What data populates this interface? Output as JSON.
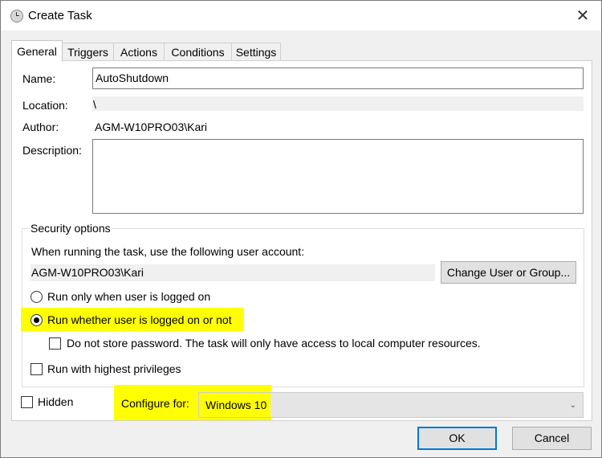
{
  "window": {
    "title": "Create Task",
    "close_icon": "close-icon"
  },
  "tabs": [
    {
      "label": "General",
      "active": true
    },
    {
      "label": "Triggers"
    },
    {
      "label": "Actions"
    },
    {
      "label": "Conditions"
    },
    {
      "label": "Settings"
    }
  ],
  "general": {
    "name_label": "Name:",
    "name_value": "AutoShutdown",
    "location_label": "Location:",
    "location_value": "\\",
    "author_label": "Author:",
    "author_value": "AGM-W10PRO03\\Kari",
    "description_label": "Description:",
    "description_value": ""
  },
  "security": {
    "title": "Security options",
    "account_prompt": "When running the task, use the following user account:",
    "account_value": "AGM-W10PRO03\\Kari",
    "change_button": "Change User or Group...",
    "radio_logged_on": "Run only when user is logged on",
    "radio_whether": "Run whether user is logged on or not",
    "selected_radio": "run-whether",
    "do_not_store": "Do not store password.  The task will only have access to local computer resources.",
    "highest_privileges": "Run with highest privileges"
  },
  "bottom": {
    "hidden_label": "Hidden",
    "configure_label": "Configure for:",
    "configure_value": "Windows 10"
  },
  "buttons": {
    "ok": "OK",
    "cancel": "Cancel"
  },
  "colors": {
    "highlight": "#ffff00",
    "default_button_border": "#0078d7"
  }
}
